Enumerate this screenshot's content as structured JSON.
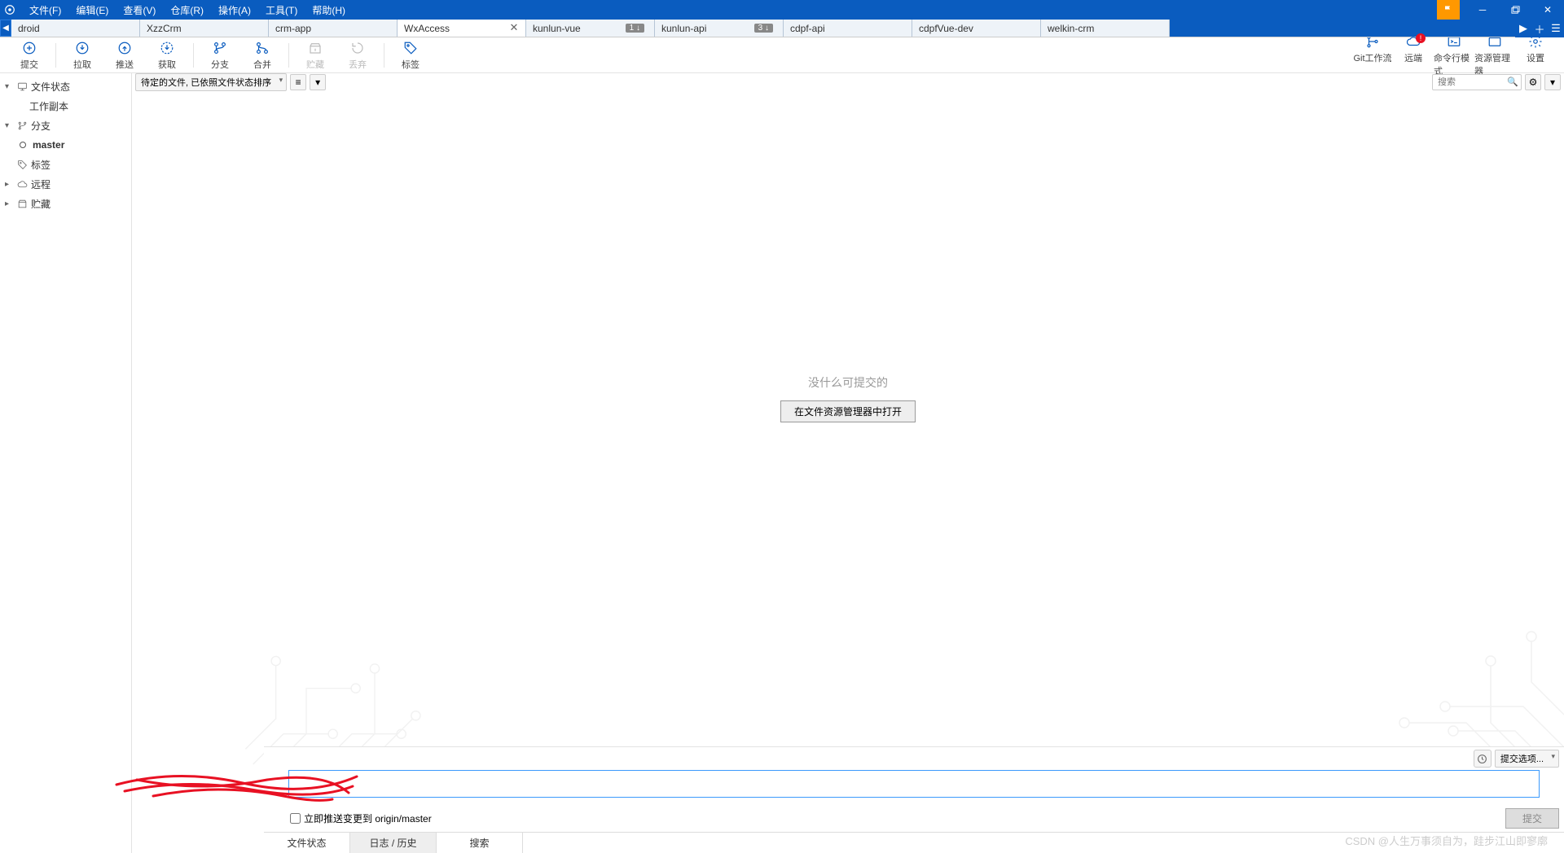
{
  "menu": {
    "file": "文件(F)",
    "edit": "编辑(E)",
    "view": "查看(V)",
    "repo": "仓库(R)",
    "action": "操作(A)",
    "tools": "工具(T)",
    "help": "帮助(H)"
  },
  "tabs": [
    {
      "label": "droid"
    },
    {
      "label": "XzzCrm"
    },
    {
      "label": "crm-app"
    },
    {
      "label": "WxAccess",
      "active": true,
      "closeable": true
    },
    {
      "label": "kunlun-vue",
      "badge": "1 ↓"
    },
    {
      "label": "kunlun-api",
      "badge": "3 ↓"
    },
    {
      "label": "cdpf-api"
    },
    {
      "label": "cdpfVue-dev"
    },
    {
      "label": "welkin-crm"
    }
  ],
  "toolbar": {
    "left": [
      {
        "k": "commit",
        "l": "提交"
      },
      {
        "k": "pull",
        "l": "拉取"
      },
      {
        "k": "push",
        "l": "推送"
      },
      {
        "k": "fetch",
        "l": "获取"
      },
      {
        "k": "branch",
        "l": "分支"
      },
      {
        "k": "merge",
        "l": "合并"
      },
      {
        "k": "stash",
        "l": "贮藏",
        "dis": true
      },
      {
        "k": "discard",
        "l": "丢弃",
        "dis": true
      },
      {
        "k": "tag",
        "l": "标签"
      }
    ],
    "right": [
      {
        "k": "gitflow",
        "l": "Git工作流"
      },
      {
        "k": "remote",
        "l": "远端",
        "notif": "!"
      },
      {
        "k": "cli",
        "l": "命令行模式"
      },
      {
        "k": "explorer",
        "l": "资源管理器"
      },
      {
        "k": "settings",
        "l": "设置"
      }
    ]
  },
  "tree": {
    "file_status": "文件状态",
    "work_copy": "工作副本",
    "branch": "分支",
    "master": "master",
    "tag": "标签",
    "remote": "远程",
    "stash": "贮藏"
  },
  "filter": {
    "dropdown": "待定的文件, 已依照文件状态排序",
    "search_ph": "搜索"
  },
  "nothing": {
    "text": "没什么可提交的",
    "btn": "在文件资源管理器中打开"
  },
  "commit": {
    "options": "提交选项...",
    "push_chk": "立即推送变更到 origin/master",
    "btn": "提交"
  },
  "bottomtabs": {
    "fs": "文件状态",
    "log": "日志 / 历史",
    "search": "搜索"
  },
  "watermark": "CSDN @人生万事须自为，跬步江山即寥廓"
}
